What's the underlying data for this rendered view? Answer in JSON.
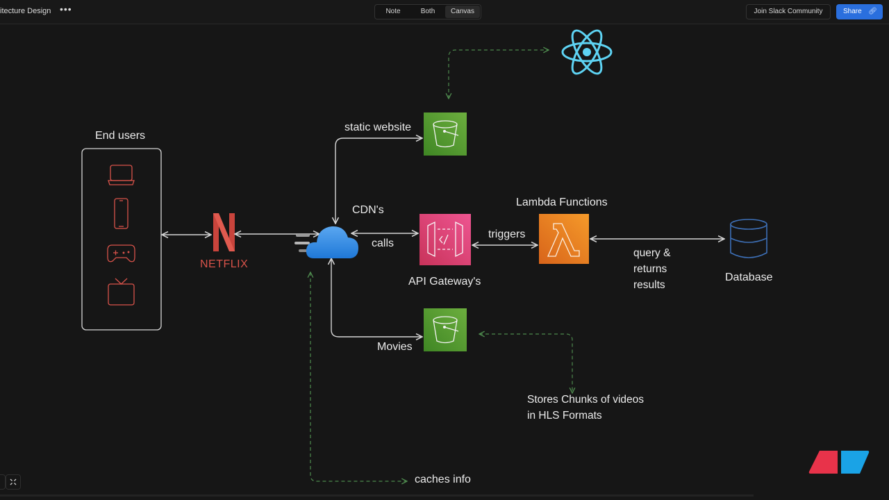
{
  "header": {
    "title": "itecture Design",
    "more_label": "•••",
    "view_options": [
      "Note",
      "Both",
      "Canvas"
    ],
    "active_view": "Canvas",
    "slack_label": "Join Slack Community",
    "share_label": "Share",
    "share_icon": "link-icon"
  },
  "colors": {
    "background": "#161616",
    "share_blue": "#2a6fde",
    "s3_green": "#4e9a2a",
    "api_pink": "#e0426f",
    "lambda_orange": "#ef7b1f",
    "react_cyan": "#5ed3f3",
    "netflix_red": "#d9534a",
    "cloud_blue": "#3b8fea",
    "db_blue": "#3d6fb6",
    "dashed_green": "#4e8a4e"
  },
  "diagram": {
    "end_users": {
      "label": "End users",
      "devices": [
        "laptop-icon",
        "phone-icon",
        "gamepad-icon",
        "tv-icon"
      ]
    },
    "netflix": {
      "label": "NETFLIX"
    },
    "cdn": {
      "label": "CDN's",
      "icon": "cloud-icon"
    },
    "static_bucket": {
      "label": "static website",
      "icon": "s3-bucket-icon"
    },
    "react": {
      "icon": "react-logo-icon"
    },
    "api_gateway": {
      "label": "API Gateway's",
      "edge_label": "calls"
    },
    "lambda": {
      "label": "Lambda Functions",
      "edge_label": "triggers"
    },
    "database": {
      "label": "Database",
      "edge_label_lines": [
        "query &",
        "returns",
        "results"
      ]
    },
    "movies_bucket": {
      "label": "Movies"
    },
    "notes": {
      "hls_lines": [
        "Stores Chunks of videos",
        "in HLS Formats"
      ],
      "cache": "caches info"
    }
  },
  "footer": {
    "fit_icon": "fit-screen-icon",
    "brand_icon": "brand-logo-icon"
  }
}
